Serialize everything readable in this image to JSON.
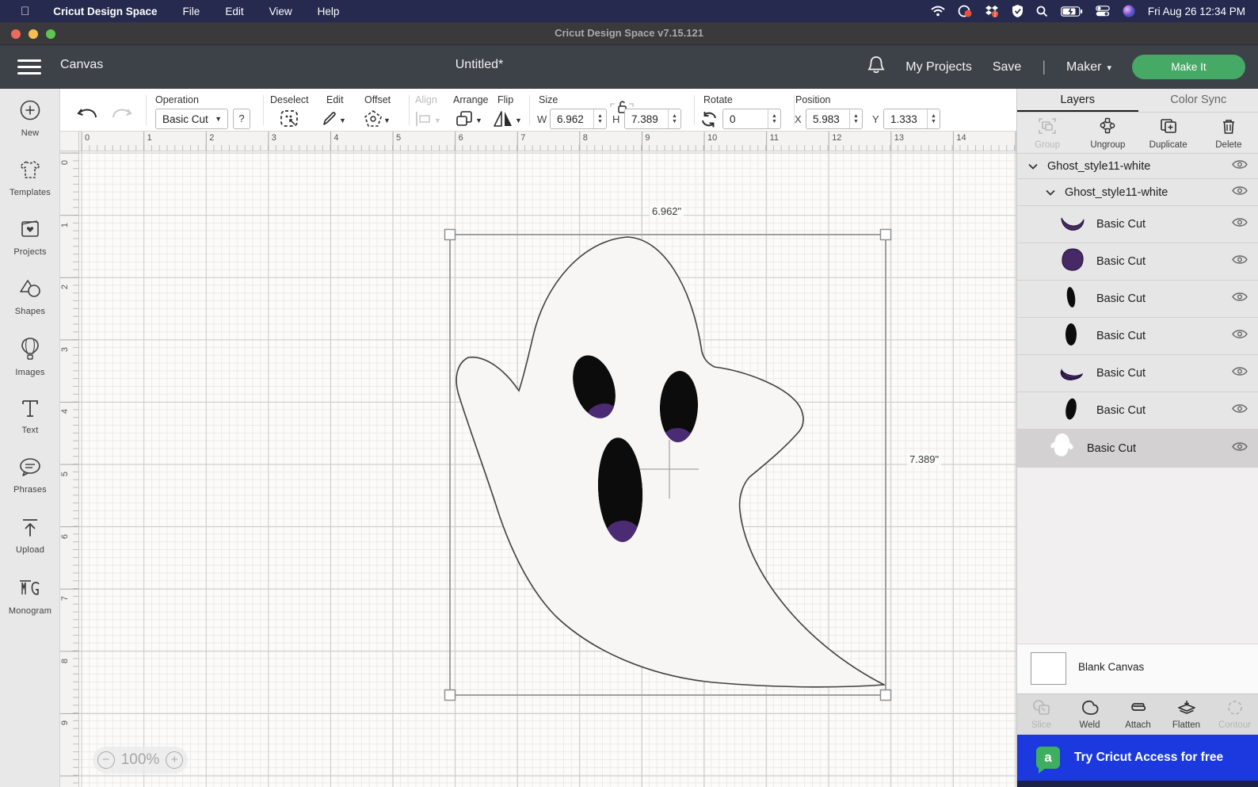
{
  "menu_bar": {
    "app_name": "Cricut Design Space",
    "items": [
      "File",
      "Edit",
      "View",
      "Help"
    ],
    "datetime": "Fri Aug 26 12:34 PM"
  },
  "title_bar": {
    "title": "Cricut Design Space  v7.15.121"
  },
  "header": {
    "canvas_label": "Canvas",
    "doc_title": "Untitled*",
    "my_projects": "My Projects",
    "save": "Save",
    "divider": "|",
    "machine": "Maker",
    "make_it": "Make It"
  },
  "toolbar": {
    "operation": {
      "label": "Operation",
      "value": "Basic Cut",
      "help": "?"
    },
    "deselect_label": "Deselect",
    "edit_label": "Edit",
    "offset_label": "Offset",
    "align_label": "Align",
    "arrange_label": "Arrange",
    "flip_label": "Flip",
    "size": {
      "label": "Size",
      "w_label": "W",
      "w_value": "6.962",
      "h_label": "H",
      "h_value": "7.389"
    },
    "rotate": {
      "label": "Rotate",
      "value": "0"
    },
    "position": {
      "label": "Position",
      "x_label": "X",
      "x_value": "5.983",
      "y_label": "Y",
      "y_value": "1.333"
    }
  },
  "sidebar": {
    "items": [
      {
        "label": "New",
        "icon": "plus-circle-icon"
      },
      {
        "label": "Templates",
        "icon": "tshirt-icon"
      },
      {
        "label": "Projects",
        "icon": "project-card-icon"
      },
      {
        "label": "Shapes",
        "icon": "shapes-icon"
      },
      {
        "label": "Images",
        "icon": "balloon-icon"
      },
      {
        "label": "Text",
        "icon": "text-icon"
      },
      {
        "label": "Phrases",
        "icon": "speech-bubble-icon"
      },
      {
        "label": "Upload",
        "icon": "upload-arrow-icon"
      },
      {
        "label": "Monogram",
        "icon": "monogram-icon"
      }
    ]
  },
  "canvas": {
    "h_ruler": [
      "0",
      "1",
      "2",
      "3",
      "4",
      "5",
      "6",
      "7",
      "8",
      "9",
      "10",
      "11",
      "12",
      "13",
      "14"
    ],
    "v_ruler": [
      "0",
      "1",
      "2",
      "3",
      "4",
      "5",
      "6",
      "7",
      "8",
      "9"
    ],
    "selection": {
      "width_label": "6.962\"",
      "height_label": "7.389\""
    },
    "zoom_value": "100%"
  },
  "layers_panel": {
    "tabs": {
      "layers": "Layers",
      "color_sync": "Color Sync"
    },
    "actions": {
      "group": "Group",
      "ungroup": "Ungroup",
      "duplicate": "Duplicate",
      "delete": "Delete"
    },
    "layers": [
      {
        "name": "Ghost_style11-white",
        "type": "group",
        "level": 0
      },
      {
        "name": "Ghost_style11-white",
        "type": "group",
        "level": 1
      },
      {
        "name": "Basic Cut",
        "thumb": "crescent-purple",
        "level": 2
      },
      {
        "name": "Basic Cut",
        "thumb": "blob-purple",
        "level": 2
      },
      {
        "name": "Basic Cut",
        "thumb": "ellipse-black-small",
        "level": 2
      },
      {
        "name": "Basic Cut",
        "thumb": "ellipse-black",
        "level": 2
      },
      {
        "name": "Basic Cut",
        "thumb": "crescent-purple",
        "level": 2
      },
      {
        "name": "Basic Cut",
        "thumb": "ellipse-black",
        "level": 2
      },
      {
        "name": "Basic Cut",
        "thumb": "ghost-white",
        "level": 1,
        "selected": true
      }
    ],
    "blank_canvas_label": "Blank Canvas",
    "tools": {
      "slice": "Slice",
      "weld": "Weld",
      "attach": "Attach",
      "flatten": "Flatten",
      "contour": "Contour"
    },
    "banner_text": "Try Cricut Access for free",
    "banner_logo_letter": "a"
  },
  "colors": {
    "menubar_bg": "#252a4e",
    "titlebar_bg": "#3a3a3c",
    "header_bg": "#3d4249",
    "accent_green": "#46a966",
    "banner_blue": "#1c39e0",
    "banner_logo_green": "#3daf5e",
    "layer_purple": "#452a66",
    "layer_black": "#0c0c0c",
    "selected_row": "#d3d1d1"
  },
  "icons": {
    "bell-icon": "notification bell outline",
    "hamburger-icon": "three bars",
    "undo-icon": "curved arrow left",
    "redo-icon": "curved arrow right",
    "lock-open-icon": "open padlock",
    "eye-icon": "visibility eye",
    "wifi-icon": "wifi arcs",
    "battery-icon": "battery charging",
    "spotlight-icon": "magnifier"
  }
}
